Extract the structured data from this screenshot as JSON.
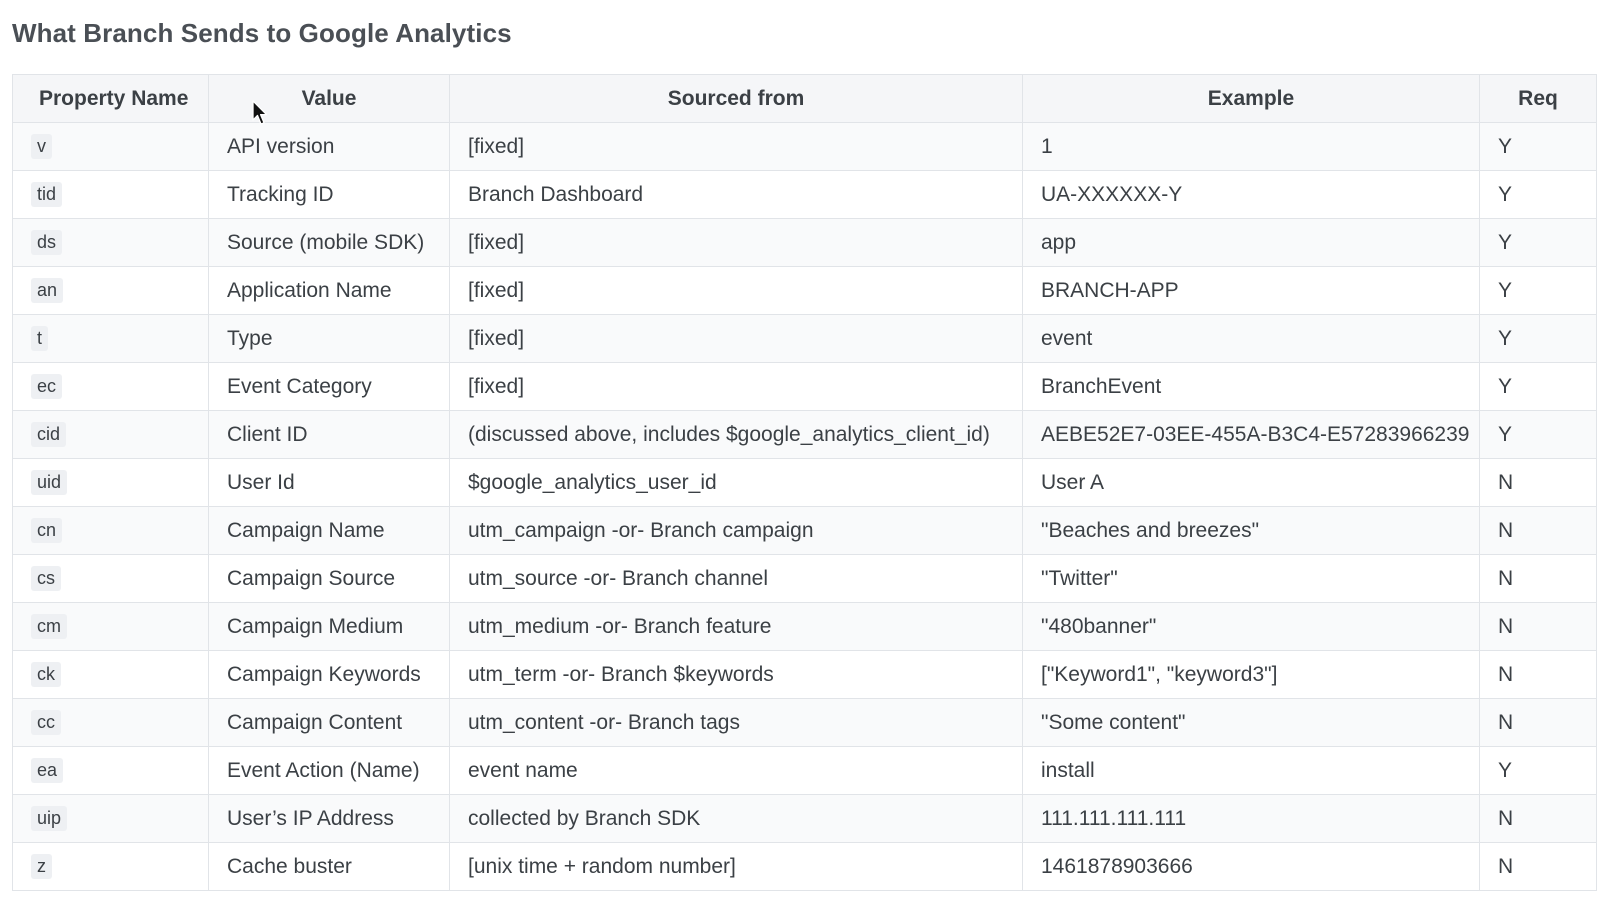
{
  "heading": "What Branch Sends to Google Analytics",
  "table": {
    "headers": [
      "Property Name",
      "Value",
      "Sourced from",
      "Example",
      "Req"
    ],
    "rows": [
      {
        "prop": "v",
        "value": "API version",
        "source": "[fixed]",
        "example": "1",
        "req": "Y"
      },
      {
        "prop": "tid",
        "value": "Tracking ID",
        "source": "Branch Dashboard",
        "example": "UA-XXXXXX-Y",
        "req": "Y"
      },
      {
        "prop": "ds",
        "value": "Source (mobile SDK)",
        "source": "[fixed]",
        "example": "app",
        "req": "Y"
      },
      {
        "prop": "an",
        "value": "Application Name",
        "source": "[fixed]",
        "example": "BRANCH-APP",
        "req": "Y"
      },
      {
        "prop": "t",
        "value": "Type",
        "source": "[fixed]",
        "example": "event",
        "req": "Y"
      },
      {
        "prop": "ec",
        "value": "Event Category",
        "source": "[fixed]",
        "example": "BranchEvent",
        "req": "Y"
      },
      {
        "prop": "cid",
        "value": "Client ID",
        "source": "(discussed above, includes $google_analytics_client_id)",
        "example": "AEBE52E7-03EE-455A-B3C4-E57283966239",
        "req": "Y"
      },
      {
        "prop": "uid",
        "value": "User Id",
        "source": "$google_analytics_user_id",
        "example": "User A",
        "req": "N"
      },
      {
        "prop": "cn",
        "value": "Campaign Name",
        "source": "utm_campaign -or- Branch campaign",
        "example": "\"Beaches and breezes\"",
        "req": "N"
      },
      {
        "prop": "cs",
        "value": "Campaign Source",
        "source": "utm_source -or- Branch channel",
        "example": "\"Twitter\"",
        "req": "N"
      },
      {
        "prop": "cm",
        "value": "Campaign Medium",
        "source": "utm_medium -or- Branch feature",
        "example": "\"480banner\"",
        "req": "N"
      },
      {
        "prop": "ck",
        "value": "Campaign Keywords",
        "source": "utm_term -or- Branch $keywords",
        "example": "[\"Keyword1\", \"keyword3\"]",
        "req": "N"
      },
      {
        "prop": "cc",
        "value": "Campaign Content",
        "source": "utm_content -or- Branch tags",
        "example": "\"Some content\"",
        "req": "N"
      },
      {
        "prop": "ea",
        "value": "Event Action (Name)",
        "source": "event name",
        "example": "install",
        "req": "Y"
      },
      {
        "prop": "uip",
        "value": "User’s IP Address",
        "source": "collected by Branch SDK",
        "example": "111.111.111.111",
        "req": "N"
      },
      {
        "prop": "z",
        "value": "Cache buster",
        "source": "[unix time + random number]",
        "example": "1461878903666",
        "req": "N"
      }
    ]
  },
  "cursor": {
    "icon": "mouse-pointer-icon"
  }
}
